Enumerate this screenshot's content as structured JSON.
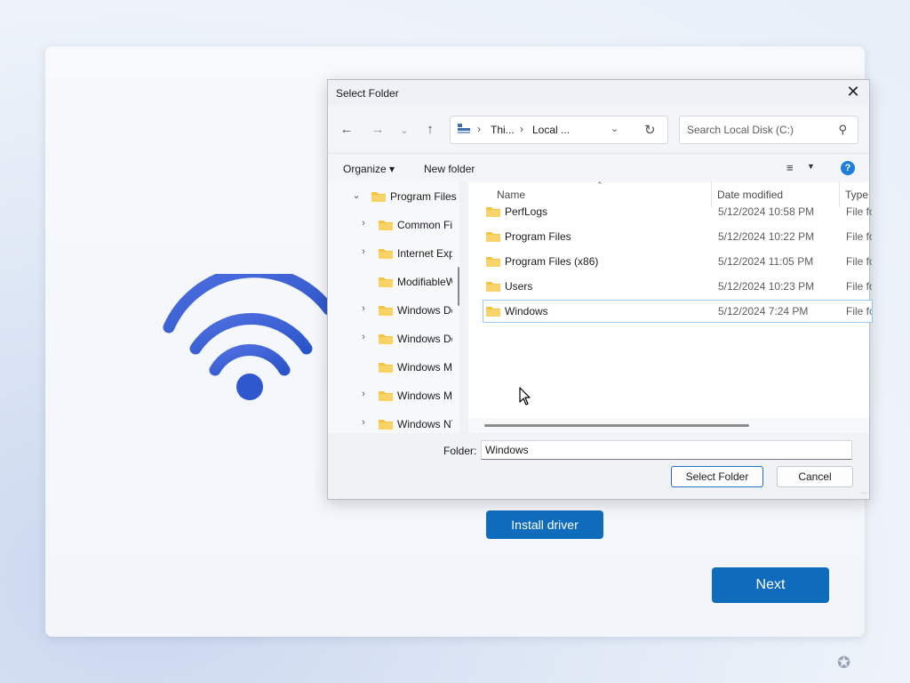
{
  "oobe": {
    "install_button": "Install driver",
    "next_button": "Next",
    "accent": "#0f6cbd"
  },
  "dialog": {
    "title": "Select Folder",
    "breadcrumb": [
      "Thi...",
      "Local ..."
    ],
    "search_placeholder": "Search Local Disk (C:)",
    "toolbar": {
      "organize": "Organize",
      "new_folder": "New folder"
    },
    "tree": [
      {
        "label": "Program Files",
        "expanded": true,
        "has_children": true
      },
      {
        "label": "Common Files",
        "has_children": true
      },
      {
        "label": "Internet Explorer",
        "has_children": true
      },
      {
        "label": "ModifiableWindowsApps",
        "has_children": false
      },
      {
        "label": "Windows Defender",
        "has_children": true
      },
      {
        "label": "Windows Defender Advanced Threat Protection",
        "has_children": true
      },
      {
        "label": "Windows Mail",
        "has_children": false
      },
      {
        "label": "Windows Media Player",
        "has_children": true
      },
      {
        "label": "Windows NT",
        "has_children": true
      }
    ],
    "columns": {
      "name": "Name",
      "date_modified": "Date modified",
      "type": "Type"
    },
    "files": [
      {
        "name": "PerfLogs",
        "date": "5/12/2024 10:58 PM",
        "type": "File folder"
      },
      {
        "name": "Program Files",
        "date": "5/12/2024 10:22 PM",
        "type": "File folder"
      },
      {
        "name": "Program Files (x86)",
        "date": "5/12/2024 11:05 PM",
        "type": "File folder"
      },
      {
        "name": "Users",
        "date": "5/12/2024 10:23 PM",
        "type": "File folder"
      },
      {
        "name": "Windows",
        "date": "5/12/2024 7:24 PM",
        "type": "File folder",
        "selected": true
      }
    ],
    "folder_label": "Folder:",
    "folder_value": "Windows",
    "select_button": "Select Folder",
    "cancel_button": "Cancel"
  },
  "icons": {
    "back": "arrow-left-icon",
    "forward": "arrow-right-icon",
    "recent": "chevron-down-icon",
    "up": "arrow-up-icon",
    "refresh": "refresh-icon",
    "search": "search-icon",
    "help": "help-icon",
    "close": "close-icon",
    "folder_color": "#f4c542"
  }
}
